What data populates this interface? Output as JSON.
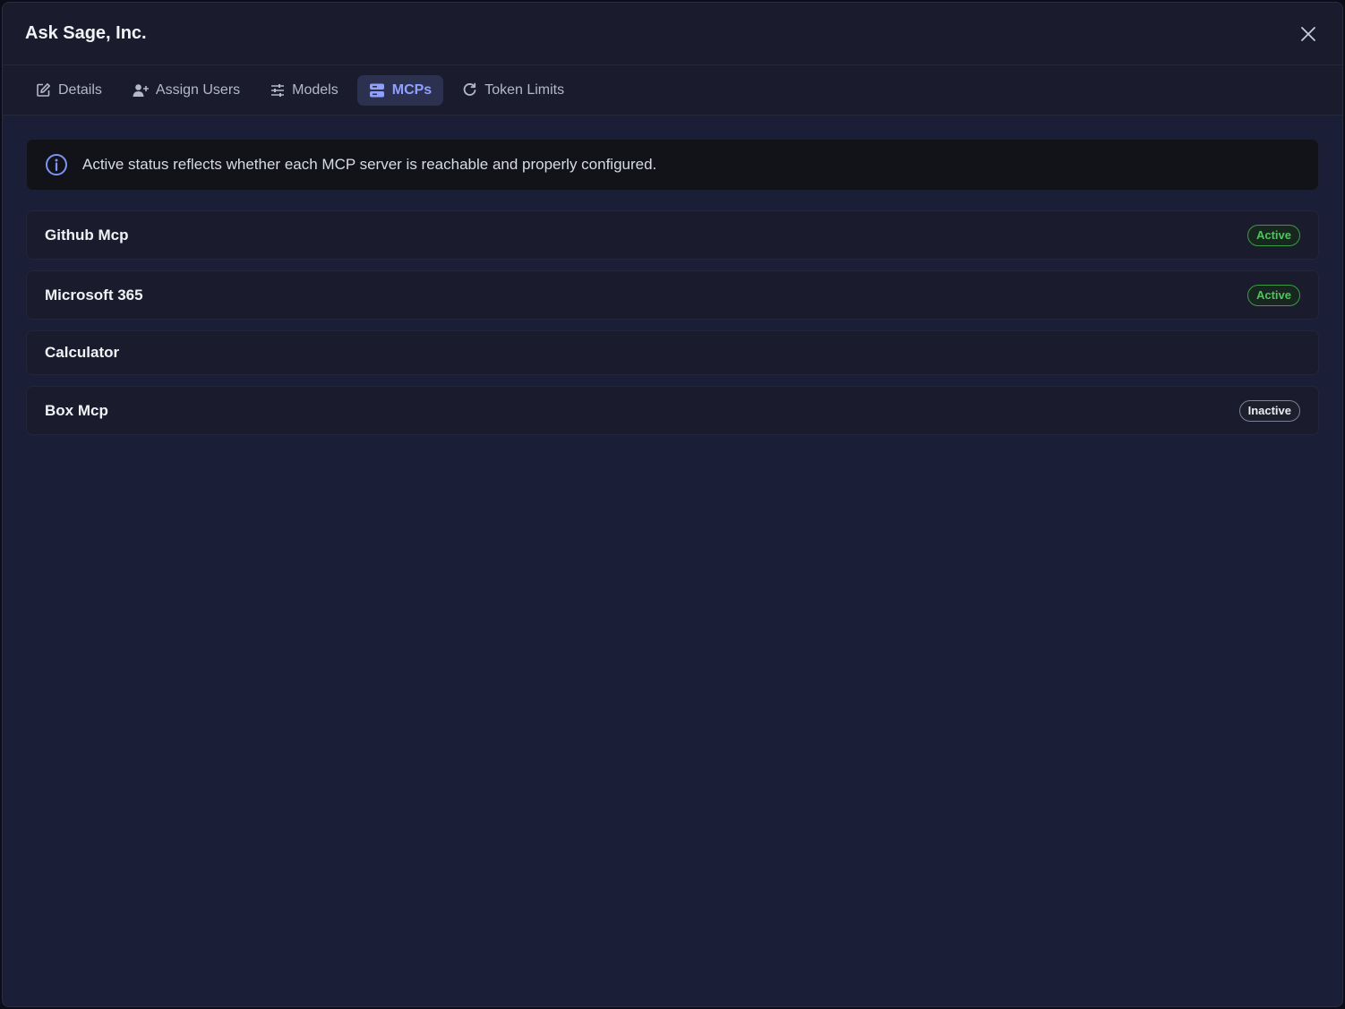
{
  "modal": {
    "title": "Ask Sage, Inc.",
    "close_icon": "close-icon"
  },
  "tabs": [
    {
      "label": "Details",
      "icon": "edit-icon",
      "active": false
    },
    {
      "label": "Assign Users",
      "icon": "user-plus-icon",
      "active": false
    },
    {
      "label": "Models",
      "icon": "sliders-icon",
      "active": false
    },
    {
      "label": "MCPs",
      "icon": "server-icon",
      "active": true
    },
    {
      "label": "Token Limits",
      "icon": "refresh-icon",
      "active": false
    }
  ],
  "info_banner": {
    "icon": "info-icon",
    "text": "Active status reflects whether each MCP server is reachable and properly configured."
  },
  "mcps": [
    {
      "name": "Github Mcp",
      "status": "Active"
    },
    {
      "name": "Microsoft 365",
      "status": "Active"
    },
    {
      "name": "Calculator",
      "status": ""
    },
    {
      "name": "Box Mcp",
      "status": "Inactive"
    }
  ],
  "colors": {
    "accent": "#8fa0ff",
    "active_status": "#4ec45b",
    "background": "#1b1e37"
  }
}
